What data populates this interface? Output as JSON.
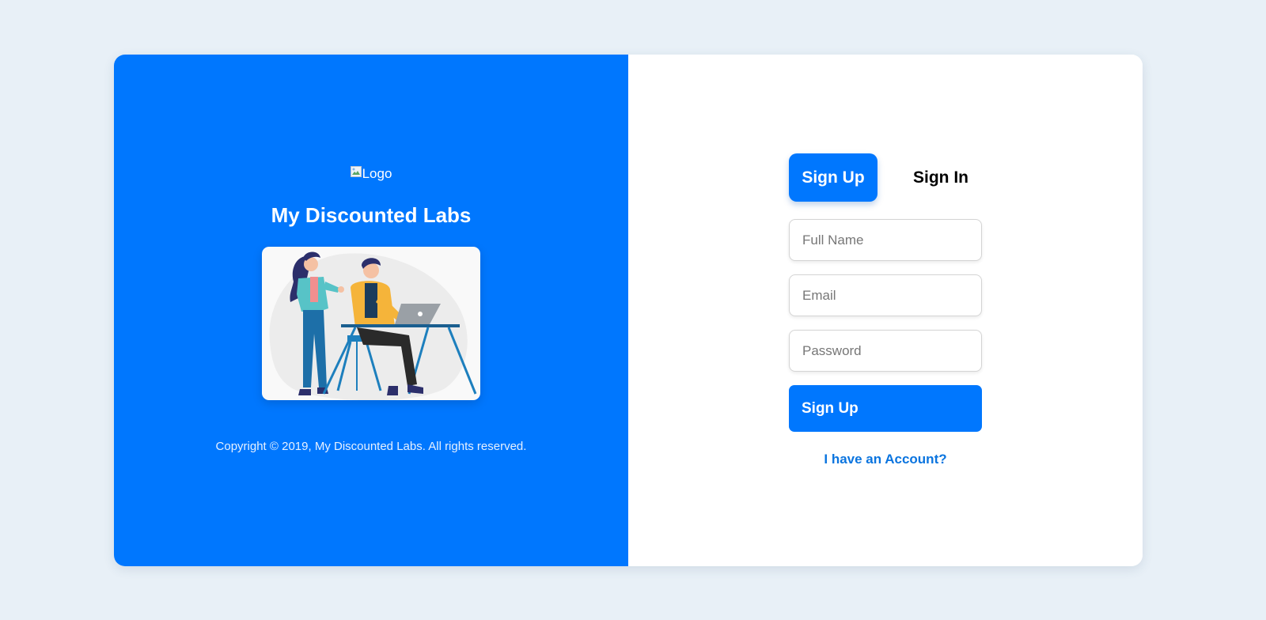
{
  "colors": {
    "page_background": "#e8f0f7",
    "brand_blue": "#0077fe",
    "link_blue": "#0a74df",
    "card_white": "#ffffff"
  },
  "left_panel": {
    "logo_alt": "Logo",
    "brand_name": "My Discounted Labs",
    "illustration_icon": "people-working-at-laptop-illustration",
    "copyright": "Copyright © 2019, My Discounted Labs. All rights reserved."
  },
  "tabs": [
    {
      "label": "Sign Up",
      "active": true
    },
    {
      "label": "Sign In",
      "active": false
    }
  ],
  "form": {
    "full_name": {
      "value": "",
      "placeholder": "Full Name"
    },
    "email": {
      "value": "",
      "placeholder": "Email"
    },
    "password": {
      "value": "",
      "placeholder": "Password"
    },
    "submit_label": "Sign Up",
    "account_link": "I have an Account?"
  }
}
